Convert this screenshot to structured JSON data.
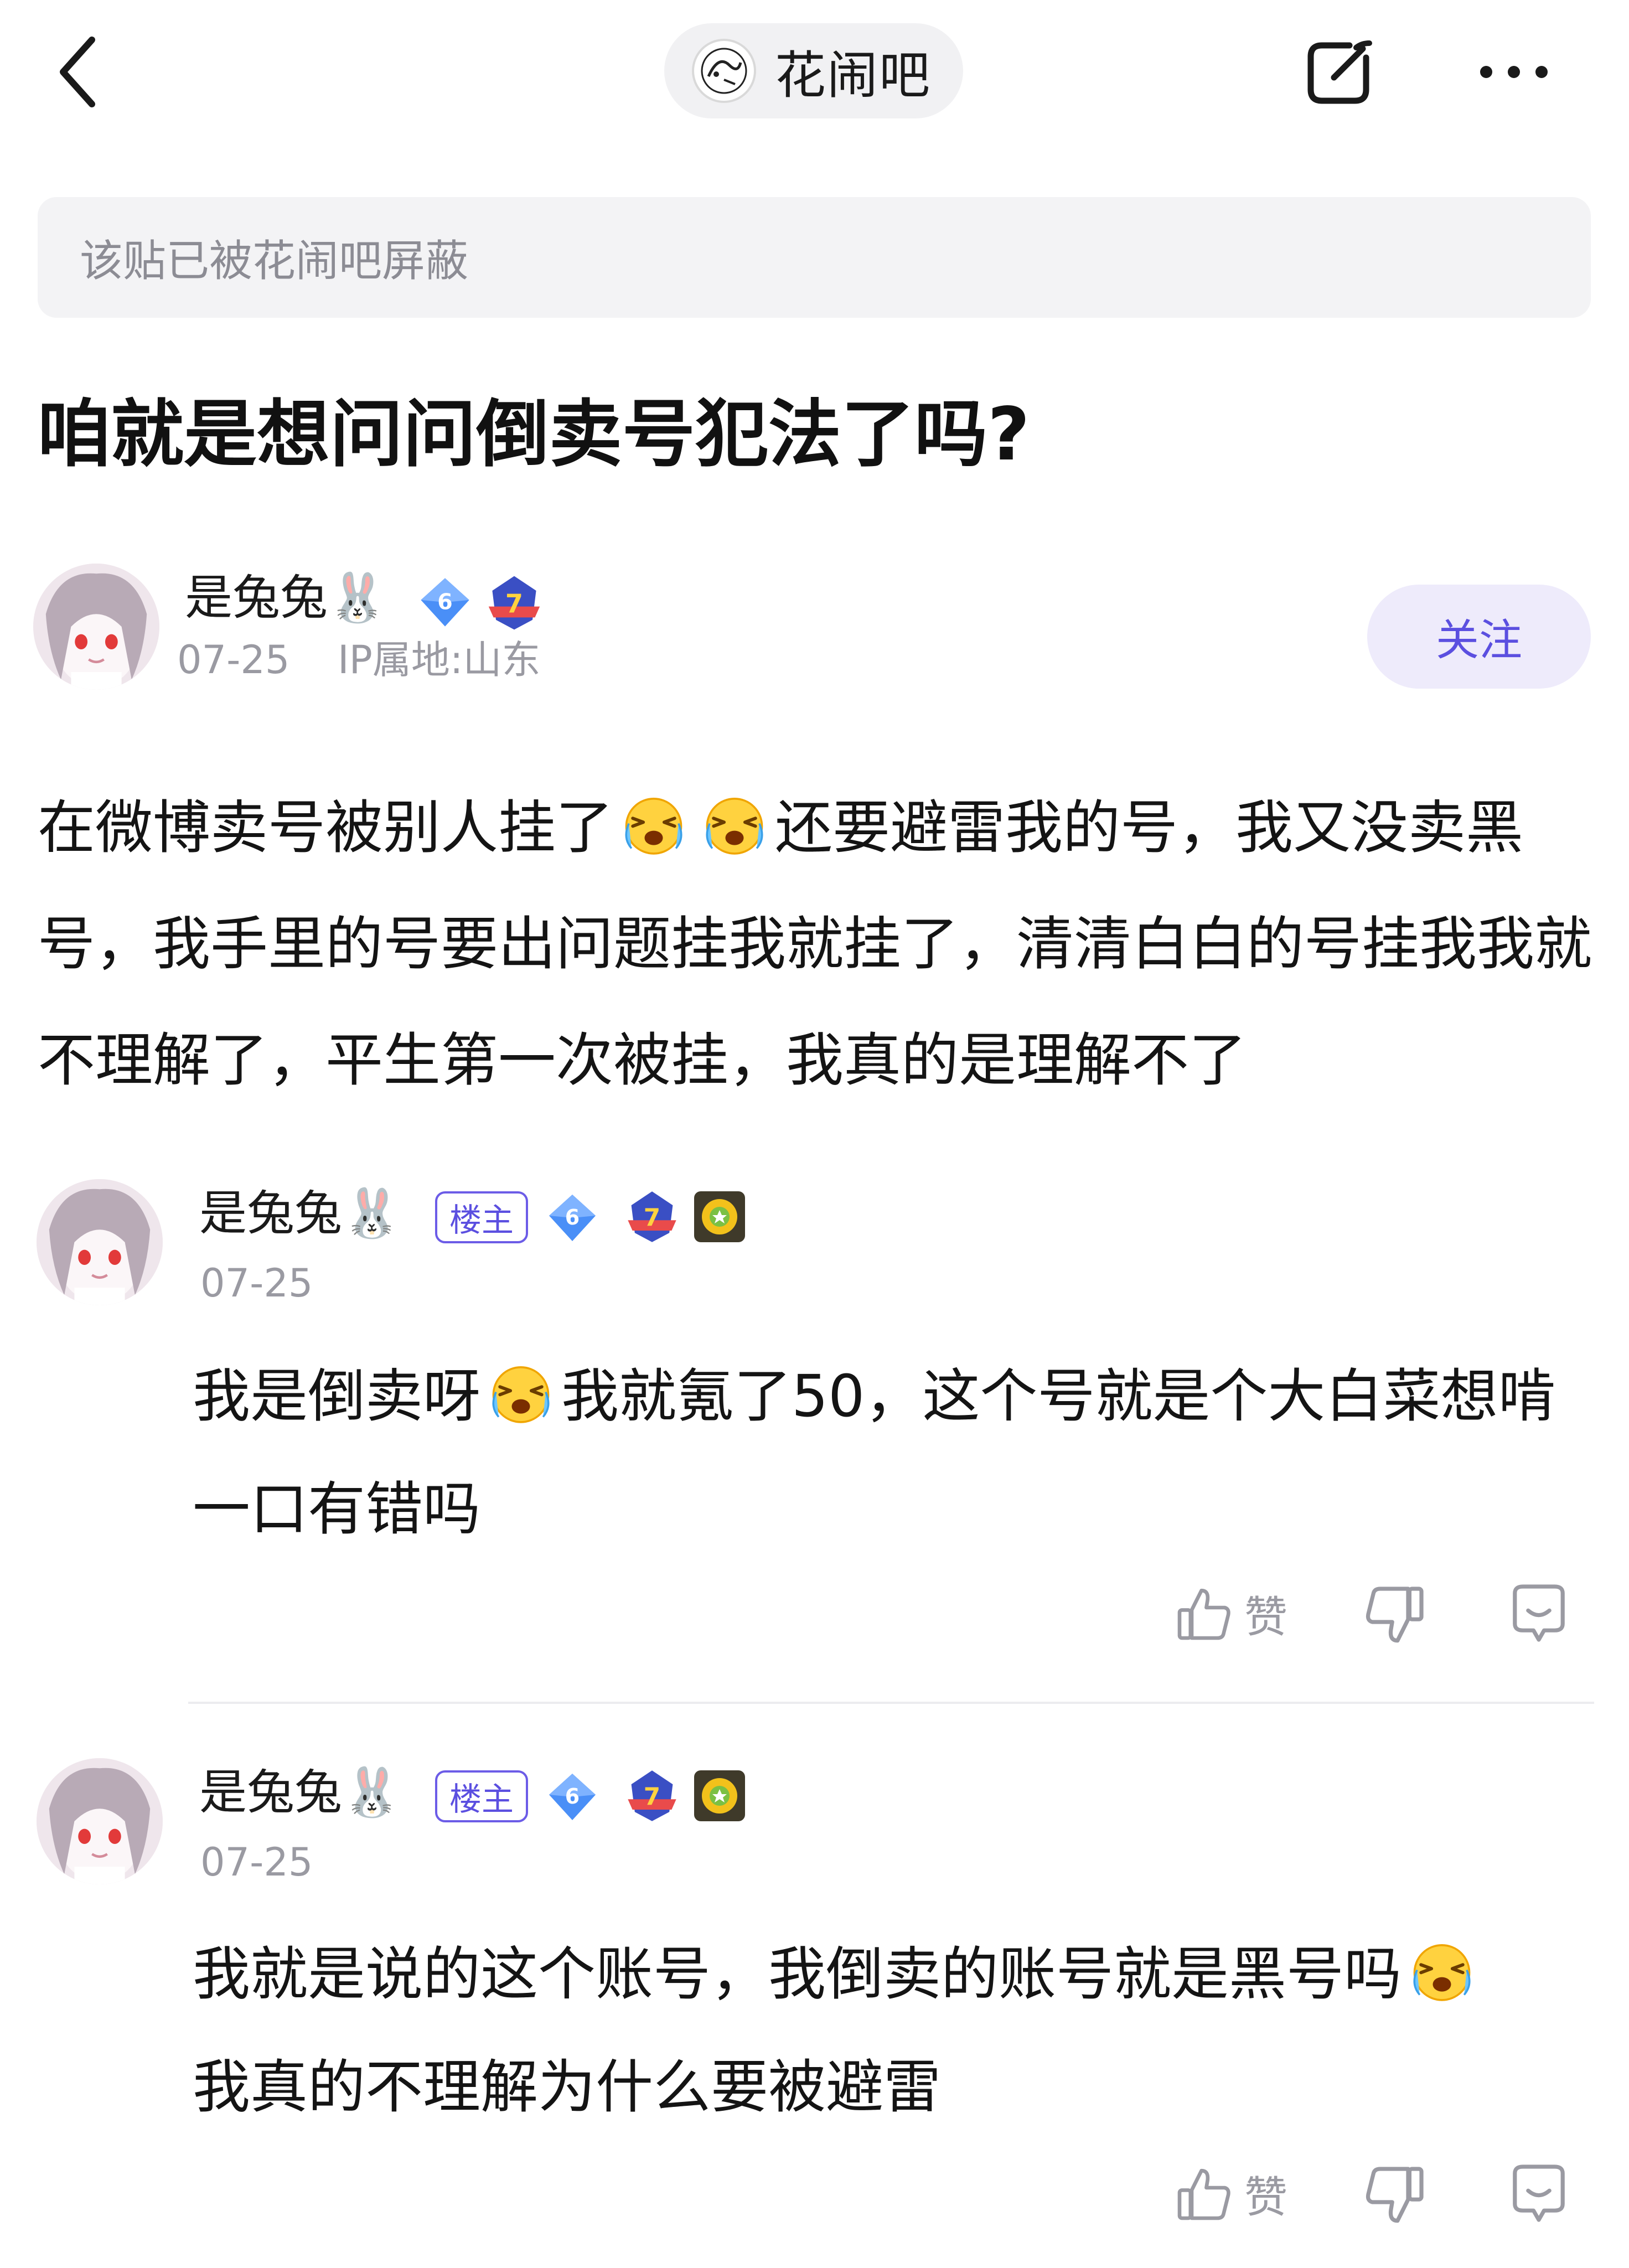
{
  "header": {
    "forum_name": "花闹吧",
    "forum_logo_text": "花闹"
  },
  "notice": "该贴已被花闹吧屏蔽",
  "post": {
    "title": "咱就是想问问倒卖号犯法了吗?",
    "author": {
      "name": "是兔兔🐰",
      "level": "6",
      "rank": "7",
      "date": "07-25",
      "ip": "IP属地:山东"
    },
    "follow_label": "关注",
    "body": {
      "part1": "在微博卖号被别人挂了",
      "part2": "还要避雷我的号，我又没卖黑号，我手里的号要出问题挂我就挂了，清清白白的号挂我我就不理解了，平生第一次被挂，我真的是理解不了"
    }
  },
  "replies": [
    {
      "name": "是兔兔🐰",
      "tag": "楼主",
      "level": "6",
      "rank": "7",
      "date": "07-25",
      "text_part1": "我是倒卖呀",
      "text_part2": "我就氪了50，这个号就是个大白菜想啃一口有错吗",
      "like_label": "赞"
    },
    {
      "name": "是兔兔🐰",
      "tag": "楼主",
      "level": "6",
      "rank": "7",
      "date": "07-25",
      "text_part1": "我就是说的这个账号，我倒卖的账号就是黑号吗",
      "text_part2": "我真的不理解为什么要被避雷",
      "like_label": "赞"
    }
  ],
  "colors": {
    "accent": "#5b4fe0",
    "notice_bg": "#f3f3f5",
    "meta_text": "#9a9aa2"
  },
  "icons": [
    "back-icon",
    "edit-icon",
    "more-icon",
    "crying-emoji-icon",
    "thumbs-up-icon",
    "thumbs-down-icon",
    "comment-icon",
    "level-diamond-icon",
    "rank-badge-icon",
    "sun-badge-icon"
  ]
}
